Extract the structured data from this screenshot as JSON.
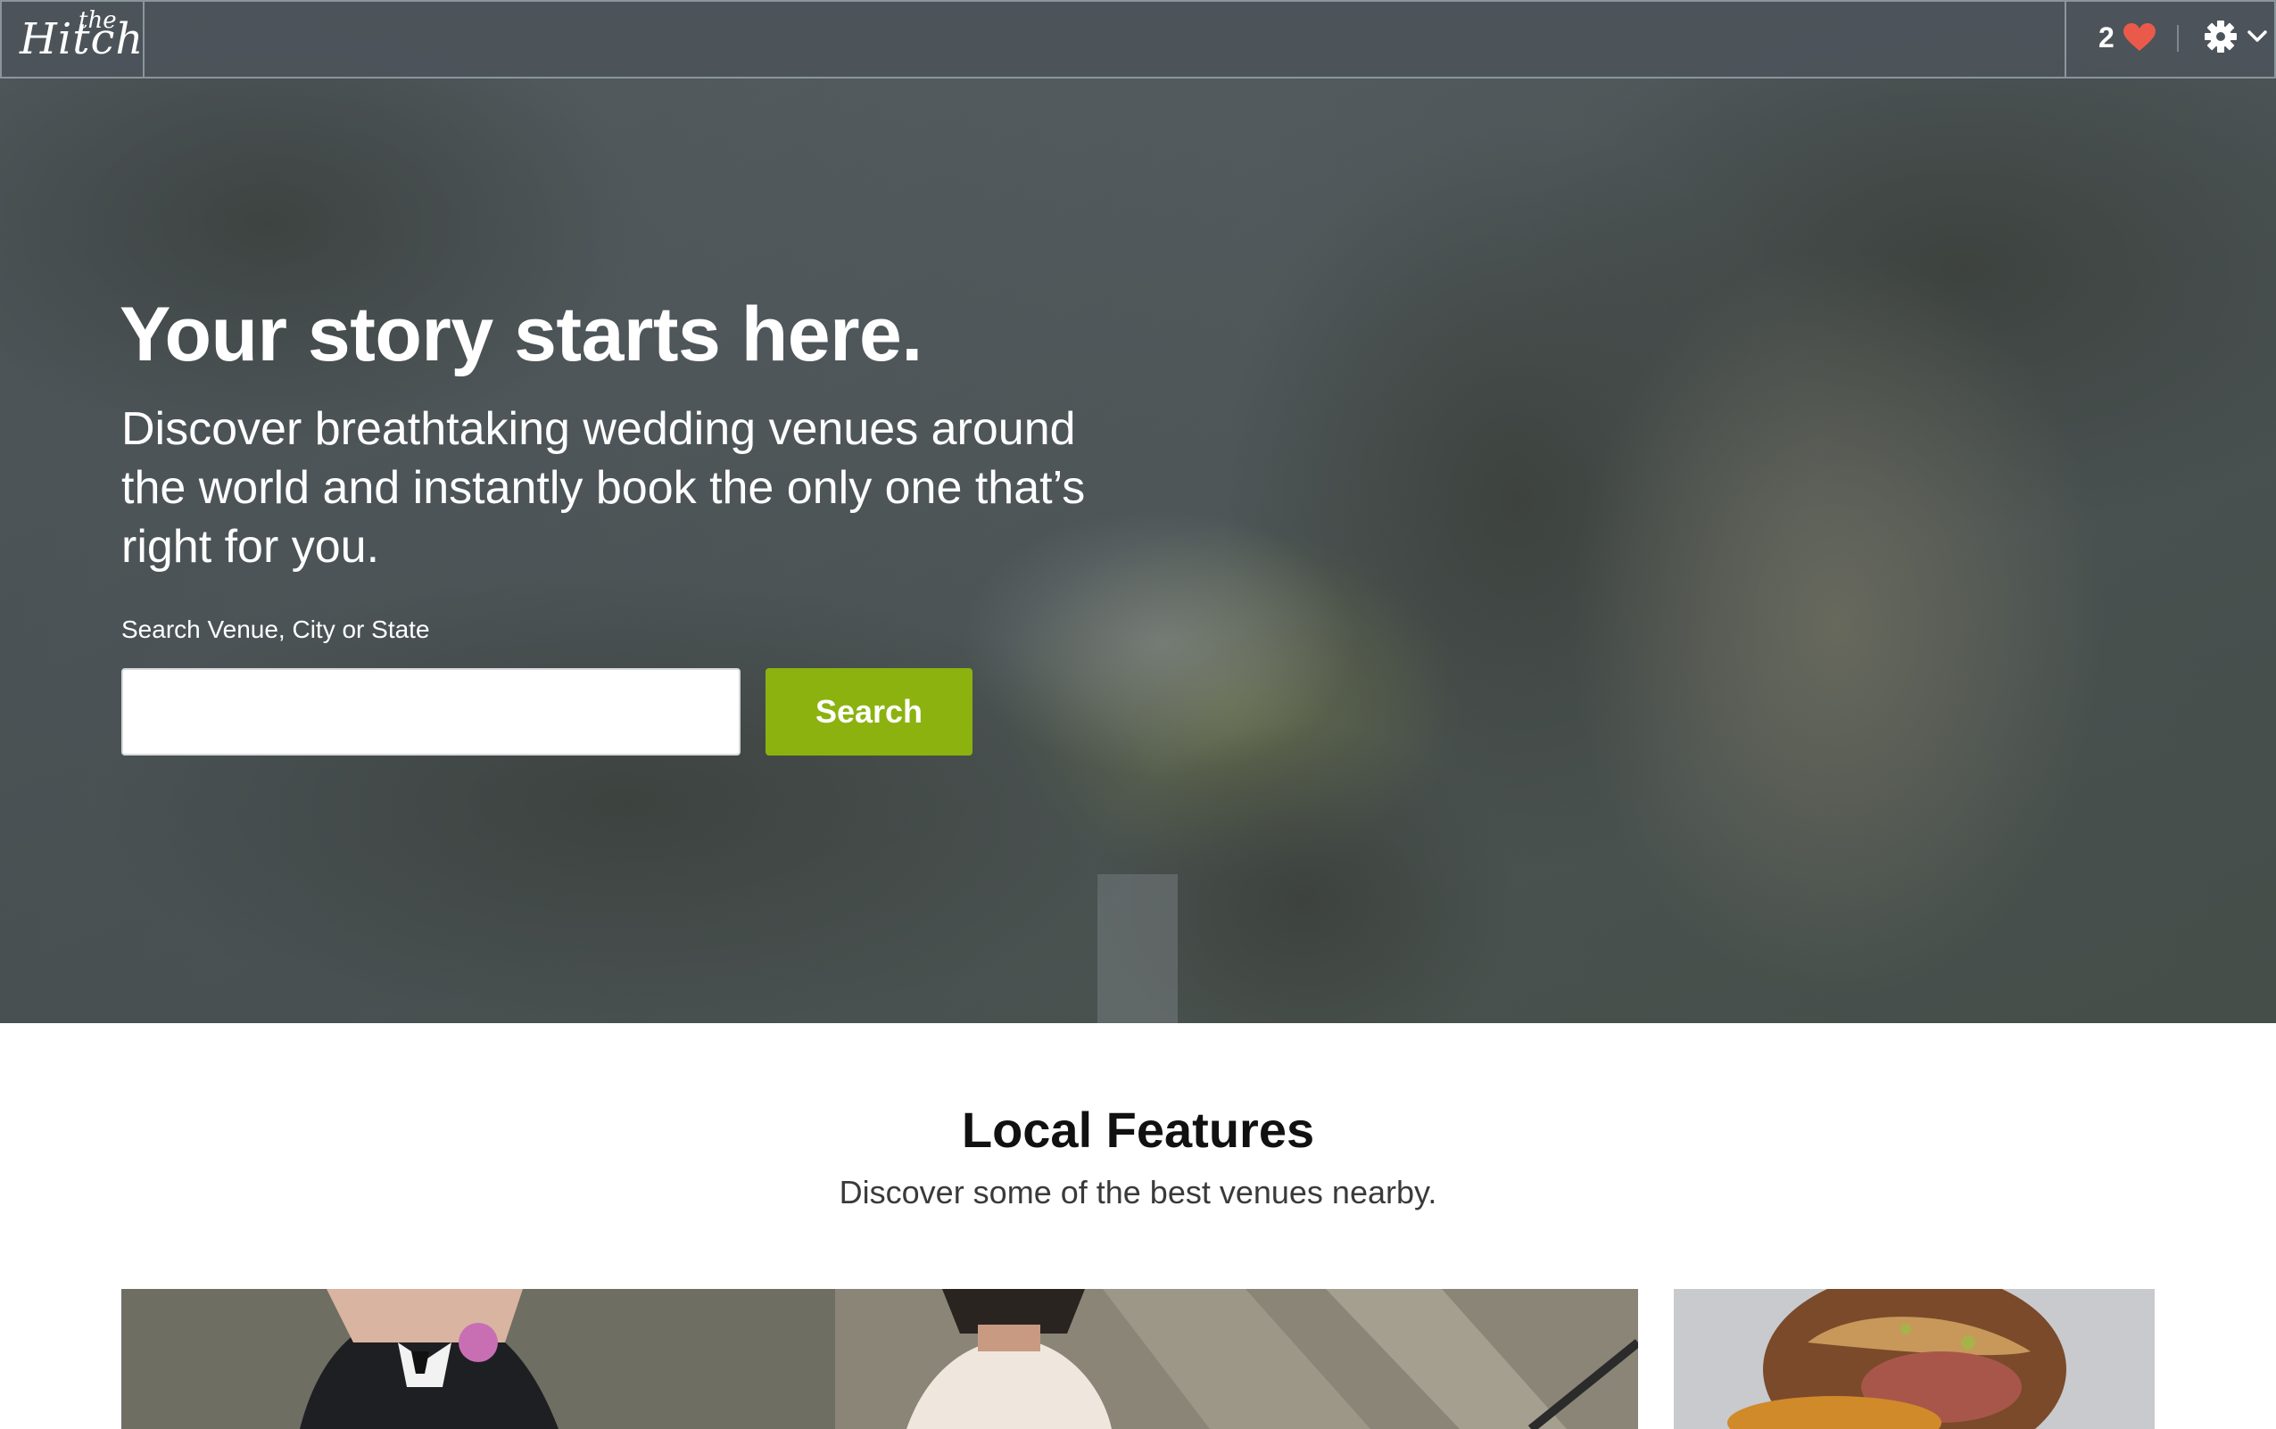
{
  "header": {
    "logo_small": "the",
    "logo_main": "Hitch",
    "favorites_count": "2"
  },
  "hero": {
    "title": "Your story starts here.",
    "subtitle": "Discover breathtaking wedding venues around the world and instantly book the only one that’s right for you.",
    "search_label": "Search Venue, City or State",
    "search_value": "",
    "search_placeholder": "",
    "search_button": "Search"
  },
  "features": {
    "title": "Local Features",
    "subtitle": "Discover some of the best venues nearby."
  },
  "colors": {
    "accent": "#8bb20f",
    "heart": "#ea5a4a",
    "topbar": "#4c545a"
  },
  "icons": [
    "heart-icon",
    "gear-icon",
    "chevron-down-icon"
  ]
}
